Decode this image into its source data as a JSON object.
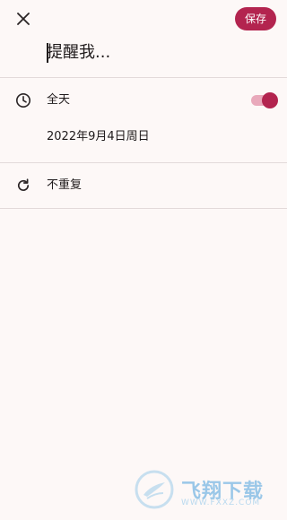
{
  "header": {
    "close_icon": "close-icon",
    "save_label": "保存"
  },
  "reminder": {
    "title_placeholder": "提醒我..."
  },
  "all_day": {
    "icon": "clock-icon",
    "label": "全天",
    "enabled": true
  },
  "date": {
    "text": "2022年9月4日周日"
  },
  "repeat": {
    "icon": "repeat-icon",
    "label": "不重复"
  },
  "watermark": {
    "text": "飞翔下载",
    "sub": "WWW.FXXZ.COM"
  },
  "colors": {
    "accent": "#b3244f",
    "background": "#fdf8f7",
    "divider": "#e3dada"
  }
}
